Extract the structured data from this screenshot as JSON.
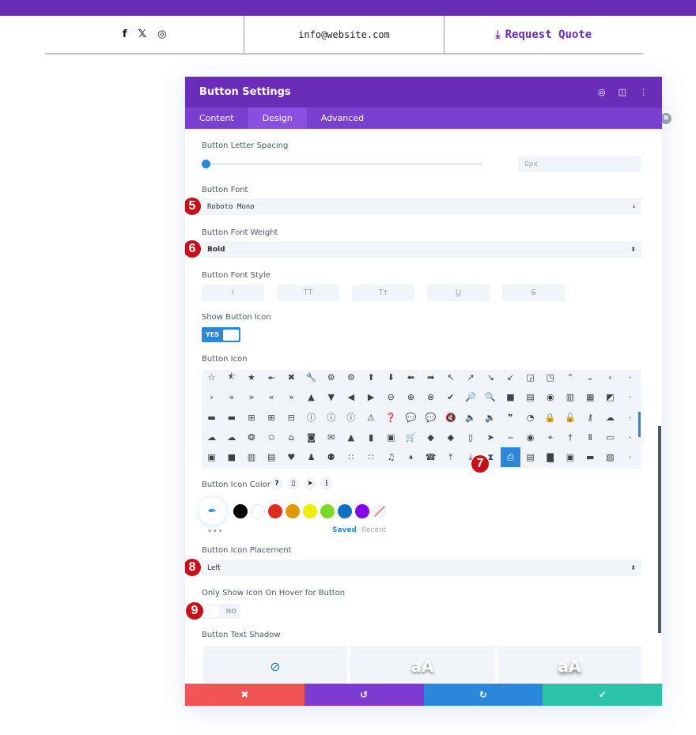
{
  "site_header": {
    "social_icons": [
      "facebook-icon",
      "twitter-icon",
      "instagram-icon"
    ],
    "social_glyphs": [
      "f",
      "🐦",
      "◎"
    ],
    "email": "info@website.com",
    "quote_icon": "download-icon",
    "quote_glyph": "⤓",
    "quote_label": "Request Quote"
  },
  "modal": {
    "title": "Button Settings",
    "header_icons": [
      "focus-icon",
      "split-view-icon",
      "more-icon"
    ],
    "header_glyphs": [
      "◎",
      "◫",
      "⋮"
    ],
    "tabs": [
      {
        "label": "Content",
        "active": false
      },
      {
        "label": "Design",
        "active": true
      },
      {
        "label": "Advanced",
        "active": false
      }
    ],
    "fields": {
      "letter_spacing": {
        "label": "Button Letter Spacing",
        "value": "0px",
        "slider_value": 0
      },
      "font": {
        "label": "Button Font",
        "value": "Roboto Mono",
        "badge": "5"
      },
      "font_weight": {
        "label": "Button Font Weight",
        "value": "Bold",
        "badge": "6"
      },
      "font_style": {
        "label": "Button Font Style",
        "options": [
          {
            "name": "italic",
            "glyph": "I"
          },
          {
            "name": "uppercase",
            "glyph": "TT"
          },
          {
            "name": "capitalize",
            "glyph": "Tᴛ"
          },
          {
            "name": "underline",
            "glyph": "U"
          },
          {
            "name": "strikethrough",
            "glyph": "S"
          }
        ]
      },
      "show_icon": {
        "label": "Show Button Icon",
        "value": "YES"
      },
      "button_icon": {
        "label": "Button Icon",
        "selected": "download",
        "badge": "7",
        "icons": [
          "☆",
          "⯪",
          "★",
          "⯬",
          "✖",
          "🔧",
          "⚙",
          "⚙",
          "⬆",
          "⬇",
          "⬅",
          "➡",
          "↖",
          "↗",
          "↘",
          "↙",
          "◲",
          "◳",
          "⌃",
          "⌄",
          "‹",
          "·",
          "›",
          "«",
          "»",
          "«",
          "»",
          "▲",
          "▼",
          "◀",
          "▶",
          "⊖",
          "⊕",
          "⊗",
          "✔",
          "🔎",
          "🔍",
          "■",
          "▤",
          "◉",
          "▥",
          "▦",
          "◩",
          "·",
          "▬",
          "▬",
          "⊞",
          "⊞",
          "⊟",
          "ⓘ",
          "ⓘ",
          "ⓘ",
          "⚠",
          "❓",
          "💬",
          "💬",
          "🔇",
          "🔈",
          "🔉",
          "❞",
          "◔",
          "🔒",
          "🔓",
          "⚷",
          "☁",
          "·",
          "☁",
          "☁",
          "❂",
          "✩",
          "⌂",
          "◙",
          "✉",
          "▲",
          "▮",
          "▣",
          "🛒",
          "◆",
          "◆",
          "▯",
          "➤",
          "ⵧ",
          "◉",
          "⌖",
          "†",
          "Ⅱ",
          "▭",
          "·",
          "▣",
          "■",
          "▥",
          "▤",
          "♥",
          "♟",
          "⚉",
          "∷",
          "∷",
          "♫",
          "⏸",
          "☎",
          "⤒",
          "⤓",
          "⧗",
          "⎙",
          "▤",
          "▇",
          "▣",
          "▬",
          "▧",
          "·"
        ]
      },
      "icon_color": {
        "label": "Button Icon Color",
        "help_glyphs": [
          "?",
          "▯",
          "➤",
          "⋮"
        ],
        "help_icons": [
          "help-icon",
          "mobile-icon",
          "pointer-icon",
          "more-icon"
        ],
        "eyedropper_glyph": "✒",
        "swatches": [
          "#000000",
          "#ffffff",
          "#e02b20",
          "#e09900",
          "#edf000",
          "#7cda24",
          "#0c71c3",
          "#8300e9"
        ],
        "dots": "•••",
        "saved_label": "Saved",
        "recent_label": "Recent"
      },
      "icon_placement": {
        "label": "Button Icon Placement",
        "value": "Left",
        "badge": "8"
      },
      "hover_icon": {
        "label": "Only Show Icon On Hover for Button",
        "value": "NO",
        "badge": "9"
      },
      "text_shadow": {
        "label": "Button Text Shadow",
        "options": [
          {
            "name": "none",
            "glyph": "⃠"
          },
          {
            "name": "shadow-1",
            "glyph": "aA"
          },
          {
            "name": "shadow-2",
            "glyph": "aA"
          }
        ]
      }
    },
    "footer": {
      "buttons": [
        {
          "name": "discard",
          "glyph": "✖",
          "color": "#ef5555"
        },
        {
          "name": "undo",
          "glyph": "↺",
          "color": "#7e3bd0"
        },
        {
          "name": "redo",
          "glyph": "↻",
          "color": "#2b87da"
        },
        {
          "name": "save",
          "glyph": "✔",
          "color": "#29c4a9"
        }
      ]
    }
  },
  "colors": {
    "brand_purple": "#6a2db8",
    "tab_purple": "#7b3fcf",
    "accent_blue": "#2b87da",
    "badge_red": "#c8101a"
  }
}
